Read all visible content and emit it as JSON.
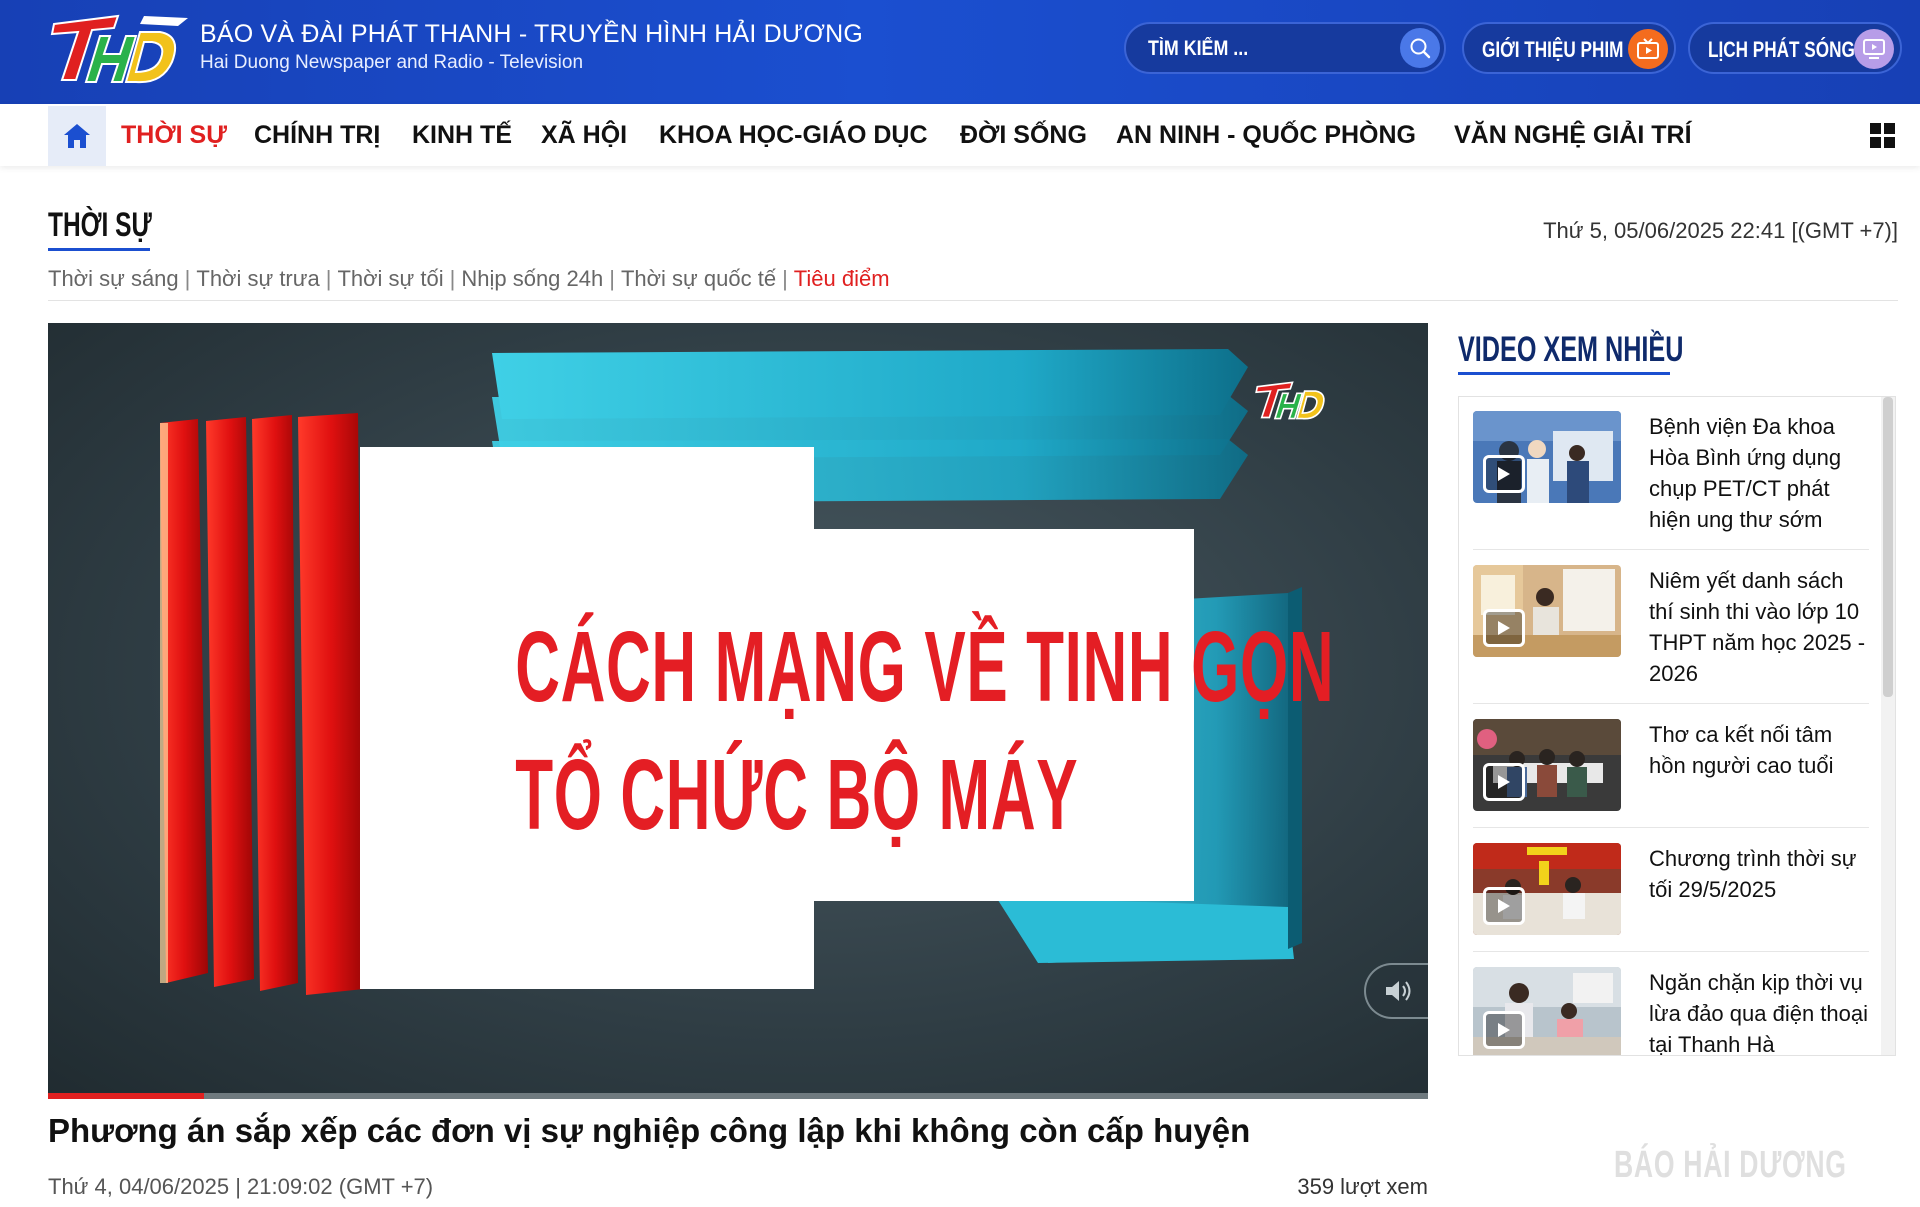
{
  "header": {
    "brand_title": "BÁO VÀ ĐÀI PHÁT THANH - TRUYỀN HÌNH HẢI DƯƠNG",
    "brand_subtitle": "Hai Duong Newspaper and Radio - Television",
    "search_placeholder": "TÌM KIẾM ...",
    "film_button": "GIỚI THIỆU PHIM",
    "schedule_button": "LỊCH PHÁT SÓNG"
  },
  "nav": {
    "items": [
      {
        "label": "THỜI SỰ"
      },
      {
        "label": "CHÍNH TRỊ"
      },
      {
        "label": "KINH TẾ"
      },
      {
        "label": "XÃ HỘI"
      },
      {
        "label": "KHOA HỌC-GIÁO DỤC"
      },
      {
        "label": "ĐỜI SỐNG"
      },
      {
        "label": "AN NINH - QUỐC PHÒNG"
      },
      {
        "label": "VĂN NGHỆ GIẢI TRÍ"
      }
    ]
  },
  "section": {
    "title": "THỜI SỰ",
    "datetime": "Thứ 5, 05/06/2025 22:41 [(GMT +7)]",
    "subnav": [
      "Thời sự sáng",
      "Thời sự trưa",
      "Thời sự tối",
      "Nhịp sống 24h",
      "Thời sự quốc tế",
      "Tiêu điểm"
    ]
  },
  "player": {
    "card_line1": "CÁCH MẠNG VỀ TINH GỌN",
    "card_line2": "TỔ CHỨC BỘ MÁY",
    "progress_fraction": 0.113
  },
  "article": {
    "title": "Phương án sắp xếp các đơn vị sự nghiệp công lập khi không còn cấp huyện",
    "meta": "Thứ 4, 04/06/2025 | 21:09:02 (GMT +7)",
    "views": "359 lượt xem"
  },
  "sidebar": {
    "title": "VIDEO XEM NHIỀU",
    "items": [
      {
        "title": "Bệnh viện Đa khoa Hòa Bình ứng dụng chụp PET/CT phát hiện ung thư sớm"
      },
      {
        "title": "Niêm yết danh sách thí sinh thi vào lớp 10 THPT năm học 2025 - 2026"
      },
      {
        "title": "Thơ ca kết nối tâm hồn người cao tuổi"
      },
      {
        "title": "Chương trình thời sự tối 29/5/2025"
      },
      {
        "title": "Ngăn chặn kịp thời vụ lừa đảo qua điện thoại tại Thanh Hà"
      }
    ]
  },
  "watermark": "BÁO HẢI DƯƠNG",
  "colors": {
    "brand_blue": "#1b4fd0",
    "accent_red": "#e02020",
    "film_orange": "#f46c1e",
    "schedule_lilac": "#b79de8"
  },
  "icons": {
    "search": "search-icon",
    "film": "tv-play-icon",
    "schedule": "monitor-play-icon",
    "home": "home-icon",
    "menu": "grid-menu-icon",
    "volume": "speaker-icon",
    "play": "play-icon"
  }
}
